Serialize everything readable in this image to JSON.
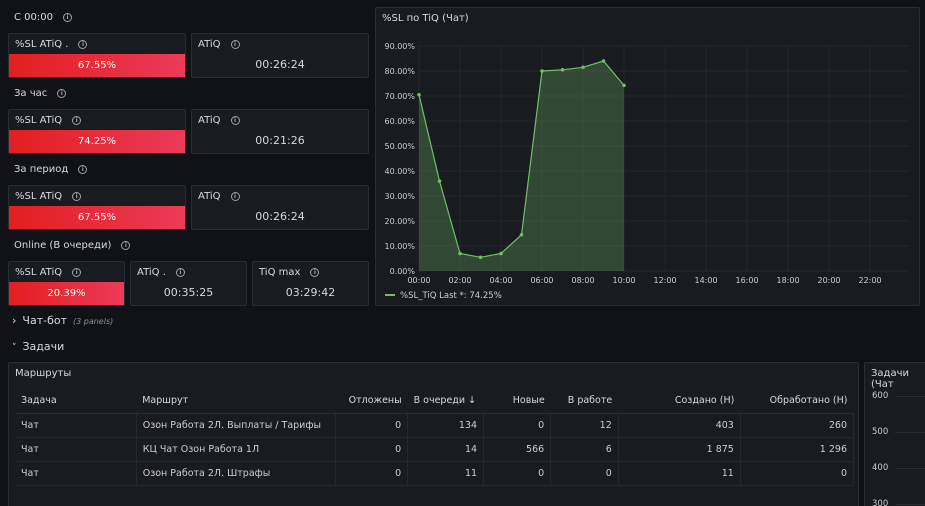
{
  "rows": {
    "since_midnight": "С 00:00",
    "hour": "За час",
    "period": "За период",
    "online": "Online (В очереди)"
  },
  "stats": {
    "r1_sl": {
      "title": "%SL ATiQ .",
      "value": "67.55%"
    },
    "r1_atiq": {
      "title": "ATiQ",
      "value": "00:26:24"
    },
    "r2_sl": {
      "title": "%SL ATiQ",
      "value": "74.25%"
    },
    "r2_atiq": {
      "title": "ATiQ",
      "value": "00:21:26"
    },
    "r3_sl": {
      "title": "%SL ATiQ",
      "value": "67.55%"
    },
    "r3_atiq": {
      "title": "ATiQ",
      "value": "00:26:24"
    },
    "r4_sl": {
      "title": "%SL ATiQ",
      "value": "20.39%"
    },
    "r4_atiq": {
      "title": "ATiQ .",
      "value": "00:35:25"
    },
    "r4_tiq": {
      "title": "TiQ max",
      "value": "03:29:42"
    }
  },
  "sections": {
    "chatbot": {
      "label": "Чат-бот",
      "sub": "(3 panels)"
    },
    "tasks": {
      "label": "Задачи"
    }
  },
  "table_panel": {
    "title": "Маршруты",
    "columns": [
      "Задача",
      "Маршрут",
      "Отложены",
      "В очереди",
      "Новые",
      "В работе",
      "Создано (Н)",
      "Обработано (Н)"
    ],
    "sort_icon": "arrow-down-icon",
    "rows": [
      [
        "Чат",
        "Озон Работа 2Л. Выплаты / Тарифы",
        "0",
        "134",
        "0",
        "12",
        "403",
        "260"
      ],
      [
        "Чат",
        "КЦ Чат Озон Работа 1Л",
        "0",
        "14",
        "566",
        "6",
        "1 875",
        "1 296"
      ],
      [
        "Чат",
        "Озон Работа 2Л. Штрафы",
        "0",
        "11",
        "0",
        "0",
        "11",
        "0"
      ]
    ]
  },
  "right_panel": {
    "title": "Задачи (Чат",
    "ticks": [
      "600",
      "500",
      "400",
      "300"
    ]
  },
  "chart_data": {
    "type": "area",
    "title": "%SL по TiQ (Чат)",
    "x_ticks": [
      "00:00",
      "02:00",
      "04:00",
      "06:00",
      "08:00",
      "10:00",
      "12:00",
      "14:00",
      "16:00",
      "18:00",
      "20:00",
      "22:00"
    ],
    "y_ticks": [
      "0.00%",
      "10.00%",
      "20.00%",
      "30.00%",
      "40.00%",
      "50.00%",
      "60.00%",
      "70.00%",
      "80.00%",
      "90.00%"
    ],
    "ylim": [
      0,
      90
    ],
    "series": [
      {
        "name": "%SL_TiQ",
        "legend": "%SL_TiQ  Last *: 74.25%",
        "color": "#73bf69",
        "x": [
          0,
          1,
          2,
          3,
          4,
          5,
          6,
          7,
          8,
          9,
          10
        ],
        "values": [
          70.5,
          36,
          7,
          5.5,
          7,
          14.5,
          80,
          80.5,
          81.5,
          84,
          74.25
        ]
      }
    ],
    "grid": true,
    "legend_position": "bottom-left"
  }
}
